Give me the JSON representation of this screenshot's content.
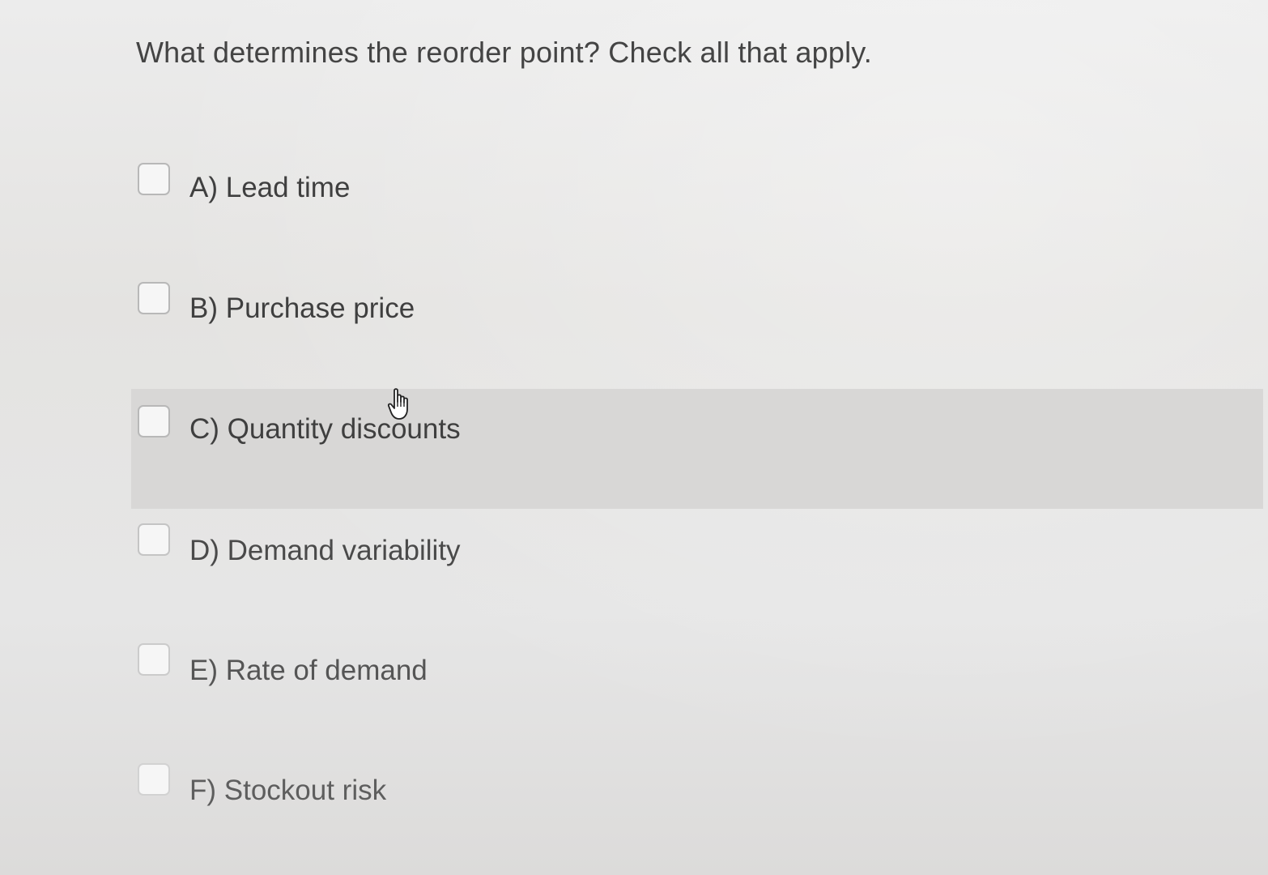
{
  "question": {
    "text": "What determines the reorder point? Check all that apply."
  },
  "options": [
    {
      "label": "A) Lead time",
      "checked": false
    },
    {
      "label": "B) Purchase price",
      "checked": false
    },
    {
      "label": "C) Quantity discounts",
      "checked": false,
      "hovered": true
    },
    {
      "label": "D) Demand variability",
      "checked": false
    },
    {
      "label": "E) Rate of demand",
      "checked": false
    },
    {
      "label": "F) Stockout risk",
      "checked": false
    }
  ],
  "cursor": {
    "icon": "hand-pointer-icon"
  }
}
